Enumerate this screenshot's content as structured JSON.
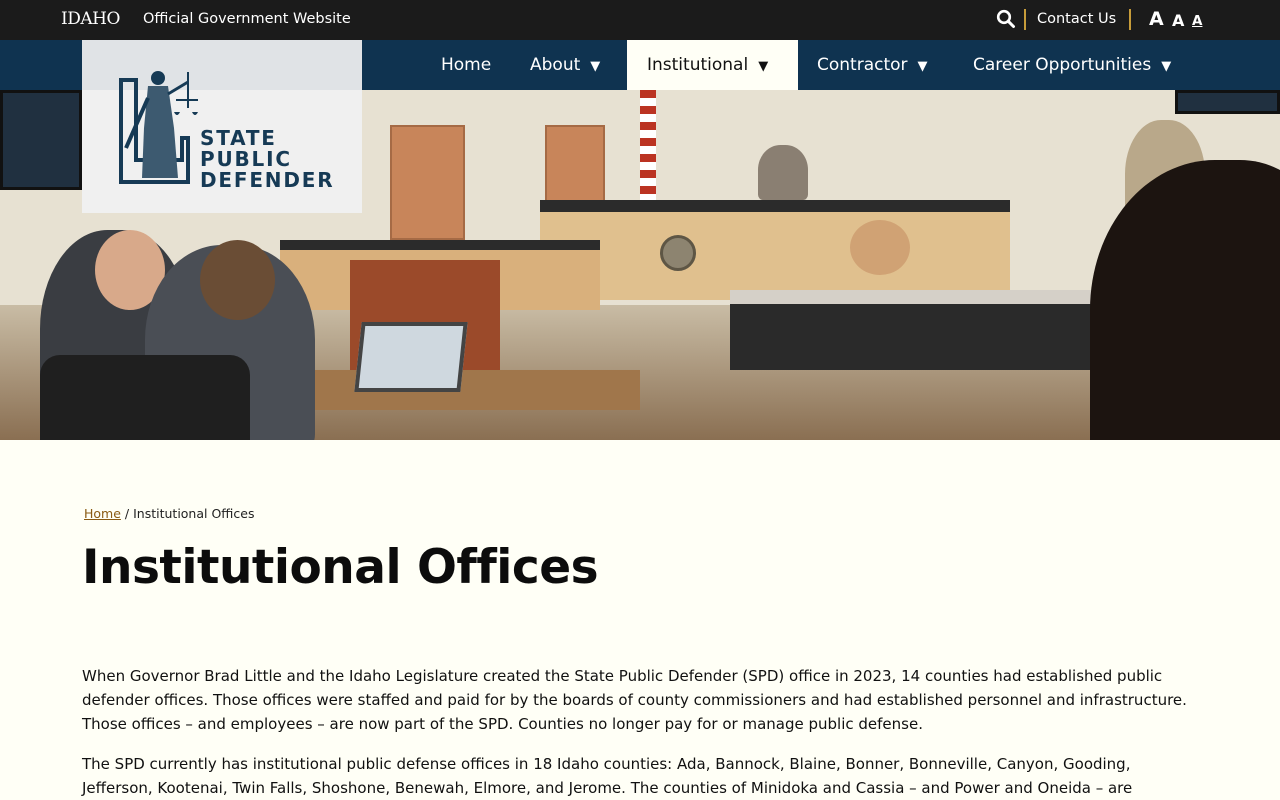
{
  "topbar": {
    "gov_logo": "IDAHO",
    "gov_label": "Official Government Website",
    "contact_label": "Contact Us",
    "font_sizes": [
      "A",
      "A",
      "A"
    ]
  },
  "nav": {
    "items": [
      {
        "label": "Home",
        "has_caret": false
      },
      {
        "label": "About",
        "has_caret": true
      },
      {
        "label": "Institutional",
        "has_caret": true,
        "active": true
      },
      {
        "label": "Contractor",
        "has_caret": true
      },
      {
        "label": "Career Opportunities",
        "has_caret": true
      }
    ],
    "caret": "▼"
  },
  "logo": {
    "line1": "STATE",
    "line2": "PUBLIC",
    "line3": "DEFENDER"
  },
  "breadcrumb": {
    "home": "Home",
    "separator": " / ",
    "current": "Institutional Offices"
  },
  "page": {
    "title": "Institutional Offices",
    "paragraph1": "When Governor Brad Little and the Idaho Legislature created the State Public Defender (SPD) office in 2023, 14 counties had established public defender offices. Those offices were staffed and paid for by the boards of county commissioners and had established personnel and infrastructure. Those offices – and employees – are now part of the SPD. Counties no longer pay for or manage public defense.",
    "paragraph2": "The SPD currently has institutional public defense offices in 18 Idaho counties: Ada, Bannock, Blaine, Bonner, Bonneville, Canyon, Gooding, Jefferson, Kootenai, Twin Falls, Shoshone, Benewah, Elmore, and Jerome. The counties of Minidoka and Cassia – and Power and Oneida – are"
  },
  "colors": {
    "topbar_bg": "#1b1b1b",
    "nav_bg": "#0f3350",
    "accent": "#c79c3a",
    "page_bg": "#fffff6",
    "logo_navy": "#163a55"
  }
}
